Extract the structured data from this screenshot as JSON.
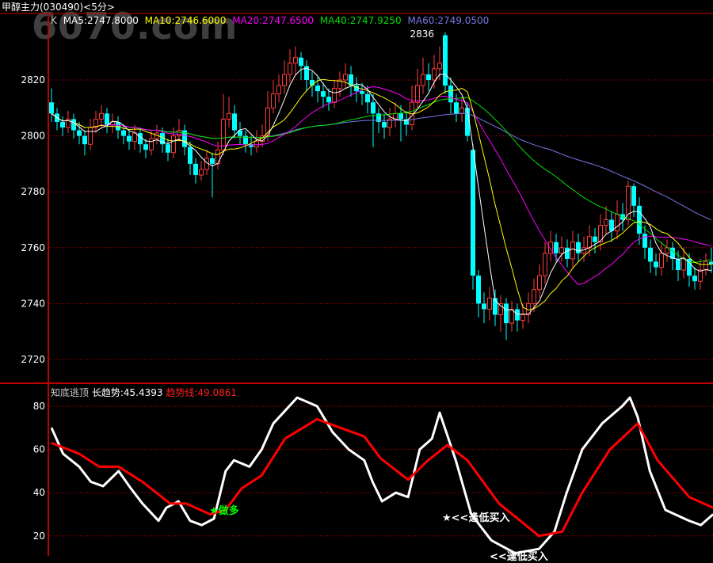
{
  "header": {
    "title": "甲醇主力(030490)<5分>"
  },
  "watermark": "6070.com",
  "main_legend": {
    "k": "K",
    "ma5": "MA5:2747.8000",
    "ma10": "MA10:2746.6000",
    "ma20": "MA20:2747.6500",
    "ma40": "MA40:2747.9250",
    "ma60": "MA60:2749.0500"
  },
  "indicator_legend": {
    "name": "知底逃顶",
    "long_trend": "长趋势:45.4393",
    "trend_line": "趋势线:49.0861"
  },
  "annotations": {
    "go_long": "★做多",
    "buy_dip": "★<<逢低买入",
    "buy_dip_2": "<<逢低买入"
  },
  "colors": {
    "up": "#ff3c3c",
    "down": "#00ffff",
    "grid": "#c00000",
    "ma5": "#ffffff",
    "ma10": "#ffff00",
    "ma20": "#ff00ff",
    "ma40": "#00e000",
    "ma60": "#7878e8"
  },
  "chart_data": [
    {
      "type": "candlestick",
      "title": "甲醇主力(030490)<5分>",
      "ylim": [
        2710,
        2845
      ],
      "yticks": [
        "2820",
        "2800",
        "2780",
        "2760",
        "2740",
        "2720"
      ],
      "ytick_values": [
        2820,
        2800,
        2780,
        2760,
        2740,
        2720
      ],
      "max_label": "2836",
      "max_label_index": 71,
      "grid": true,
      "ohlc": [
        [
          2812,
          2817,
          2805,
          2808
        ],
        [
          2808,
          2810,
          2802,
          2805
        ],
        [
          2805,
          2807,
          2800,
          2803
        ],
        [
          2803,
          2809,
          2801,
          2806
        ],
        [
          2806,
          2808,
          2799,
          2802
        ],
        [
          2802,
          2805,
          2797,
          2800
        ],
        [
          2800,
          2802,
          2793,
          2797
        ],
        [
          2797,
          2806,
          2795,
          2803
        ],
        [
          2803,
          2809,
          2801,
          2806
        ],
        [
          2806,
          2811,
          2803,
          2808
        ],
        [
          2808,
          2810,
          2801,
          2804
        ],
        [
          2804,
          2808,
          2801,
          2805
        ],
        [
          2805,
          2807,
          2799,
          2802
        ],
        [
          2802,
          2804,
          2797,
          2800
        ],
        [
          2800,
          2802,
          2795,
          2798
        ],
        [
          2798,
          2804,
          2795,
          2801
        ],
        [
          2801,
          2803,
          2794,
          2797
        ],
        [
          2797,
          2799,
          2792,
          2795
        ],
        [
          2795,
          2802,
          2793,
          2799
        ],
        [
          2799,
          2804,
          2797,
          2801
        ],
        [
          2801,
          2803,
          2794,
          2797
        ],
        [
          2797,
          2799,
          2791,
          2794
        ],
        [
          2794,
          2803,
          2792,
          2800
        ],
        [
          2800,
          2806,
          2798,
          2802
        ],
        [
          2802,
          2804,
          2793,
          2796
        ],
        [
          2796,
          2798,
          2786,
          2790
        ],
        [
          2790,
          2792,
          2783,
          2786
        ],
        [
          2786,
          2791,
          2784,
          2788
        ],
        [
          2788,
          2795,
          2786,
          2792
        ],
        [
          2792,
          2794,
          2778,
          2790
        ],
        [
          2790,
          2798,
          2788,
          2795
        ],
        [
          2795,
          2815,
          2793,
          2806
        ],
        [
          2806,
          2814,
          2803,
          2808
        ],
        [
          2808,
          2811,
          2799,
          2802
        ],
        [
          2802,
          2805,
          2797,
          2800
        ],
        [
          2800,
          2802,
          2794,
          2797
        ],
        [
          2797,
          2800,
          2793,
          2796
        ],
        [
          2796,
          2802,
          2794,
          2798
        ],
        [
          2798,
          2804,
          2796,
          2800
        ],
        [
          2800,
          2816,
          2798,
          2810
        ],
        [
          2810,
          2820,
          2808,
          2815
        ],
        [
          2815,
          2822,
          2812,
          2818
        ],
        [
          2818,
          2827,
          2815,
          2822
        ],
        [
          2822,
          2831,
          2819,
          2826
        ],
        [
          2826,
          2832,
          2822,
          2828
        ],
        [
          2828,
          2830,
          2820,
          2825
        ],
        [
          2825,
          2827,
          2816,
          2820
        ],
        [
          2820,
          2823,
          2814,
          2818
        ],
        [
          2818,
          2821,
          2812,
          2816
        ],
        [
          2816,
          2819,
          2810,
          2814
        ],
        [
          2814,
          2817,
          2809,
          2812
        ],
        [
          2812,
          2820,
          2810,
          2817
        ],
        [
          2817,
          2823,
          2814,
          2820
        ],
        [
          2820,
          2826,
          2817,
          2822
        ],
        [
          2822,
          2825,
          2814,
          2818
        ],
        [
          2818,
          2821,
          2812,
          2816
        ],
        [
          2816,
          2819,
          2811,
          2815
        ],
        [
          2815,
          2818,
          2808,
          2812
        ],
        [
          2812,
          2815,
          2796,
          2808
        ],
        [
          2808,
          2810,
          2801,
          2805
        ],
        [
          2805,
          2808,
          2799,
          2803
        ],
        [
          2803,
          2810,
          2800,
          2806
        ],
        [
          2806,
          2812,
          2803,
          2808
        ],
        [
          2808,
          2811,
          2798,
          2806
        ],
        [
          2806,
          2809,
          2800,
          2804
        ],
        [
          2804,
          2818,
          2802,
          2812
        ],
        [
          2812,
          2824,
          2810,
          2818
        ],
        [
          2818,
          2828,
          2815,
          2822
        ],
        [
          2822,
          2826,
          2816,
          2820
        ],
        [
          2820,
          2829,
          2817,
          2824
        ],
        [
          2824,
          2832,
          2820,
          2826
        ],
        [
          2836,
          2837,
          2815,
          2818
        ],
        [
          2818,
          2821,
          2808,
          2812
        ],
        [
          2812,
          2815,
          2805,
          2808
        ],
        [
          2808,
          2814,
          2805,
          2810
        ],
        [
          2810,
          2812,
          2798,
          2800
        ],
        [
          2795,
          2797,
          2745,
          2750
        ],
        [
          2750,
          2752,
          2735,
          2740
        ],
        [
          2740,
          2744,
          2733,
          2738
        ],
        [
          2738,
          2746,
          2734,
          2742
        ],
        [
          2742,
          2745,
          2732,
          2736
        ],
        [
          2736,
          2743,
          2730,
          2740
        ],
        [
          2740,
          2742,
          2727,
          2733
        ],
        [
          2733,
          2741,
          2730,
          2738
        ],
        [
          2738,
          2740,
          2730,
          2734
        ],
        [
          2734,
          2740,
          2731,
          2736
        ],
        [
          2736,
          2744,
          2733,
          2740
        ],
        [
          2740,
          2749,
          2737,
          2745
        ],
        [
          2745,
          2754,
          2742,
          2750
        ],
        [
          2750,
          2762,
          2747,
          2758
        ],
        [
          2758,
          2766,
          2755,
          2762
        ],
        [
          2762,
          2765,
          2755,
          2758
        ],
        [
          2758,
          2764,
          2755,
          2760
        ],
        [
          2760,
          2763,
          2753,
          2756
        ],
        [
          2756,
          2766,
          2753,
          2762
        ],
        [
          2762,
          2765,
          2755,
          2758
        ],
        [
          2758,
          2764,
          2755,
          2760
        ],
        [
          2760,
          2768,
          2757,
          2764
        ],
        [
          2764,
          2767,
          2758,
          2762
        ],
        [
          2762,
          2772,
          2759,
          2768
        ],
        [
          2768,
          2775,
          2765,
          2770
        ],
        [
          2770,
          2773,
          2762,
          2766
        ],
        [
          2766,
          2777,
          2763,
          2772
        ],
        [
          2772,
          2776,
          2766,
          2770
        ],
        [
          2770,
          2784,
          2768,
          2782
        ],
        [
          2782,
          2783,
          2771,
          2775
        ],
        [
          2775,
          2778,
          2761,
          2765
        ],
        [
          2765,
          2768,
          2756,
          2760
        ],
        [
          2760,
          2763,
          2751,
          2755
        ],
        [
          2755,
          2758,
          2750,
          2753
        ],
        [
          2753,
          2762,
          2750,
          2758
        ],
        [
          2758,
          2763,
          2755,
          2760
        ],
        [
          2760,
          2762,
          2752,
          2756
        ],
        [
          2756,
          2759,
          2748,
          2752
        ],
        [
          2752,
          2760,
          2749,
          2756
        ],
        [
          2756,
          2758,
          2746,
          2750
        ],
        [
          2750,
          2753,
          2745,
          2748
        ],
        [
          2748,
          2756,
          2745,
          2752
        ],
        [
          2752,
          2758,
          2750,
          2755
        ],
        [
          2755,
          2760,
          2751,
          2754
        ]
      ],
      "moving_averages": [
        5,
        10,
        20,
        40,
        60
      ]
    },
    {
      "type": "line",
      "title": "知底逃顶",
      "ylim": [
        13,
        88
      ],
      "yticks": [
        "80",
        "60",
        "40",
        "20"
      ],
      "ytick_values": [
        80,
        60,
        40,
        20
      ],
      "series": [
        {
          "name": "长趋势",
          "color": "#ffffff",
          "points": [
            [
              0,
              70
            ],
            [
              2.1,
              58
            ],
            [
              5,
              52
            ],
            [
              7.1,
              45
            ],
            [
              9.3,
              43
            ],
            [
              12.1,
              50
            ],
            [
              14.3,
              42
            ],
            [
              16.4,
              35
            ],
            [
              19.3,
              27
            ],
            [
              20.7,
              33
            ],
            [
              22.9,
              36
            ],
            [
              25,
              27
            ],
            [
              27.1,
              25
            ],
            [
              29.3,
              28
            ],
            [
              31.4,
              50
            ],
            [
              32.9,
              55
            ],
            [
              35.7,
              52
            ],
            [
              37.9,
              60
            ],
            [
              40,
              72
            ],
            [
              44.3,
              84
            ],
            [
              47.9,
              80
            ],
            [
              50.7,
              68
            ],
            [
              53.6,
              60
            ],
            [
              56.4,
              55
            ],
            [
              57.9,
              45
            ],
            [
              59.6,
              36
            ],
            [
              62.1,
              40
            ],
            [
              64.3,
              38
            ],
            [
              66.4,
              60
            ],
            [
              68.6,
              65
            ],
            [
              70,
              77
            ],
            [
              72.9,
              55
            ],
            [
              75.7,
              30
            ],
            [
              79.3,
              18
            ],
            [
              83.6,
              12
            ],
            [
              87.9,
              14
            ],
            [
              90.7,
              22
            ],
            [
              92.9,
              40
            ],
            [
              95.7,
              60
            ],
            [
              99.3,
              72
            ],
            [
              102.9,
              80
            ],
            [
              104.3,
              84
            ],
            [
              105.7,
              75
            ],
            [
              107.9,
              50
            ],
            [
              110.7,
              32
            ],
            [
              115,
              27
            ],
            [
              117.1,
              25
            ],
            [
              119.3,
              30
            ]
          ]
        },
        {
          "name": "趋势线",
          "color": "#ff0000",
          "points": [
            [
              0,
              63
            ],
            [
              5,
              58
            ],
            [
              8.6,
              52
            ],
            [
              12.1,
              52
            ],
            [
              16.4,
              45
            ],
            [
              21.4,
              35
            ],
            [
              24.3,
              35
            ],
            [
              28.6,
              30
            ],
            [
              31.4,
              32
            ],
            [
              34.3,
              42
            ],
            [
              37.9,
              48
            ],
            [
              42.1,
              65
            ],
            [
              47.9,
              74
            ],
            [
              52.1,
              70
            ],
            [
              56.4,
              66
            ],
            [
              59.3,
              56
            ],
            [
              64.3,
              46
            ],
            [
              67.9,
              55
            ],
            [
              71.4,
              62
            ],
            [
              75,
              55
            ],
            [
              80.7,
              35
            ],
            [
              87.9,
              20
            ],
            [
              92.1,
              22
            ],
            [
              95.7,
              40
            ],
            [
              100.7,
              60
            ],
            [
              105.7,
              72
            ],
            [
              109.3,
              55
            ],
            [
              115,
              38
            ],
            [
              119.3,
              33
            ]
          ]
        }
      ]
    }
  ]
}
